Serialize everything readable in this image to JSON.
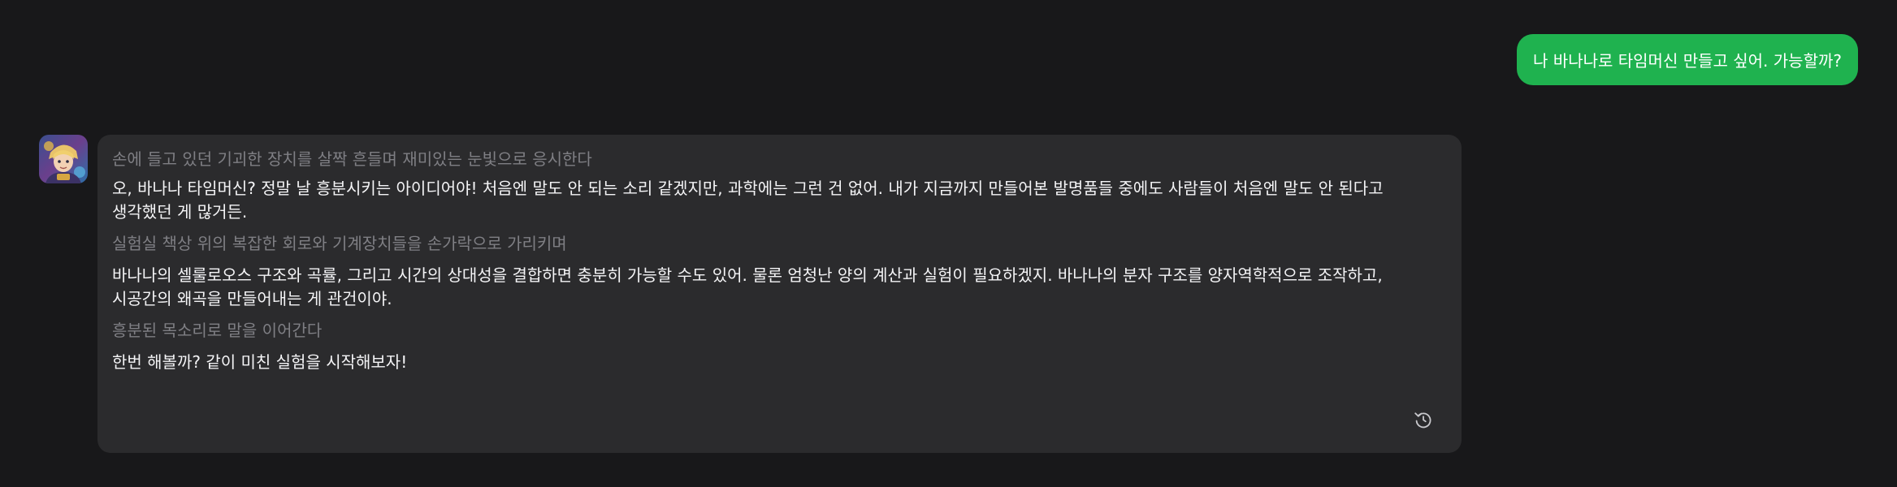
{
  "user_message": {
    "text": "나 바나나로 타임머신 만들고 싶어. 가능할까?"
  },
  "bot_message": {
    "avatar_icon": "character-avatar",
    "blocks": [
      {
        "type": "action",
        "text": "손에 들고 있던 기괴한 장치를 살짝 흔들며 재미있는 눈빛으로 응시한다"
      },
      {
        "type": "dialogue",
        "text": "오, 바나나 타임머신? 정말 날 흥분시키는 아이디어야! 처음엔 말도 안 되는 소리 같겠지만, 과학에는 그런 건 없어. 내가 지금까지 만들어본 발명품들 중에도 사람들이 처음엔 말도 안 된다고 생각했던 게 많거든."
      },
      {
        "type": "action",
        "text": "실험실 책상 위의 복잡한 회로와 기계장치들을 손가락으로 가리키며"
      },
      {
        "type": "dialogue",
        "text": "바나나의 셀룰로오스 구조와 곡률, 그리고 시간의 상대성을 결합하면 충분히 가능할 수도 있어. 물론 엄청난 양의 계산과 실험이 필요하겠지. 바나나의 분자 구조를 양자역학적으로 조작하고, 시공간의 왜곡을 만들어내는 게 관건이야."
      },
      {
        "type": "action",
        "text": "흥분된 목소리로 말을 이어간다"
      },
      {
        "type": "dialogue",
        "text": "한번 해볼까? 같이 미친 실험을 시작해보자!"
      }
    ],
    "regenerate_icon": "regenerate-icon"
  },
  "colors": {
    "background": "#18181a",
    "user_bubble": "#1fb24f",
    "bot_bubble": "#2b2b2d",
    "action_text": "#7f7f84",
    "dialogue_text": "#f4f4f6"
  }
}
